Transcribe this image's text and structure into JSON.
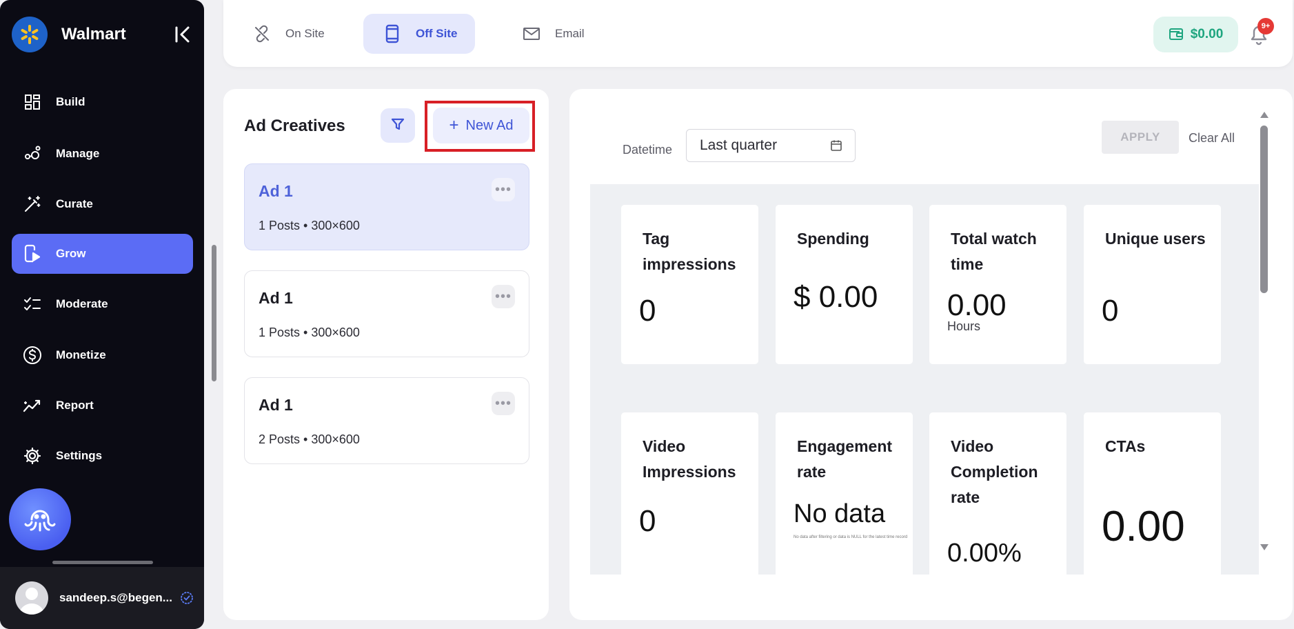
{
  "sidebar": {
    "brand": "Walmart",
    "items": [
      {
        "label": "Build",
        "icon": "layout-grid-icon"
      },
      {
        "label": "Manage",
        "icon": "nodes-icon"
      },
      {
        "label": "Curate",
        "icon": "magic-wand-icon"
      },
      {
        "label": "Grow",
        "icon": "video-phone-icon",
        "active": true
      },
      {
        "label": "Moderate",
        "icon": "checklist-icon"
      },
      {
        "label": "Monetize",
        "icon": "dollar-circle-icon"
      },
      {
        "label": "Report",
        "icon": "trend-chart-icon"
      },
      {
        "label": "Settings",
        "icon": "gear-icon"
      }
    ],
    "user_email": "sandeep.s@begen..."
  },
  "topbar": {
    "tabs": [
      {
        "label": "On Site",
        "icon": "link-off-icon"
      },
      {
        "label": "Off Site",
        "icon": "phone-icon",
        "active": true
      },
      {
        "label": "Email",
        "icon": "mail-icon"
      }
    ],
    "wallet_balance": "$0.00",
    "notification_badge": "9+"
  },
  "ad_creatives": {
    "title": "Ad Creatives",
    "new_ad_label": "New Ad",
    "new_ad_plus": "+",
    "more_glyph": "•••",
    "cards": [
      {
        "name": "Ad 1",
        "meta": "1 Posts • 300×600",
        "selected": true
      },
      {
        "name": "Ad 1",
        "meta": "1 Posts • 300×600",
        "selected": false
      },
      {
        "name": "Ad 1",
        "meta": "2 Posts • 300×600",
        "selected": false
      }
    ]
  },
  "dashboard": {
    "datetime_label": "Datetime",
    "datetime_value": "Last quarter",
    "apply_label": "APPLY",
    "clear_label": "Clear All",
    "metrics": [
      {
        "label": "Tag impressions",
        "value": "0"
      },
      {
        "label": "Spending",
        "value": "$ 0.00"
      },
      {
        "label": "Total watch time",
        "value": "0.00",
        "sub": "Hours"
      },
      {
        "label": "Unique users",
        "value": "0"
      },
      {
        "label": "Video Impressions",
        "value": "0"
      },
      {
        "label": "Engagement rate",
        "value": "No data",
        "note": "No data after filtering or data is NULL for the latest time record"
      },
      {
        "label": "Video Completion rate",
        "value": "0.00%"
      },
      {
        "label": "CTAs",
        "value": "0.00"
      }
    ]
  },
  "colors": {
    "accent": "#5b6cf5",
    "sidebar_bg": "#0b0b14",
    "wallet_green": "#1ea57f",
    "highlight_red": "#d81f26"
  }
}
